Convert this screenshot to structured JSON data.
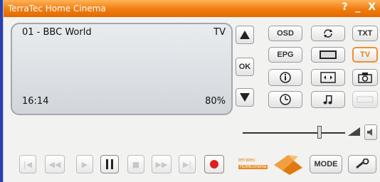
{
  "window": {
    "title": "TerraTec Home Cinema",
    "help": "?",
    "minimize": "_",
    "close": "X"
  },
  "screen": {
    "channel": "01 - BBC World",
    "mode": "TV",
    "time": "16:14",
    "volume": "80%"
  },
  "buttons": {
    "osd": "OSD",
    "ok": "OK",
    "epg": "EPG",
    "txt": "TXT",
    "tv": "TV",
    "mode": "MODE"
  },
  "volume_slider": {
    "level": 0.75
  },
  "logo": {
    "line1": "terratec",
    "line2": "HOMEcinema"
  },
  "colors": {
    "title_bar": "#f07c10",
    "accent": "#f07c10",
    "record": "#e02020"
  }
}
